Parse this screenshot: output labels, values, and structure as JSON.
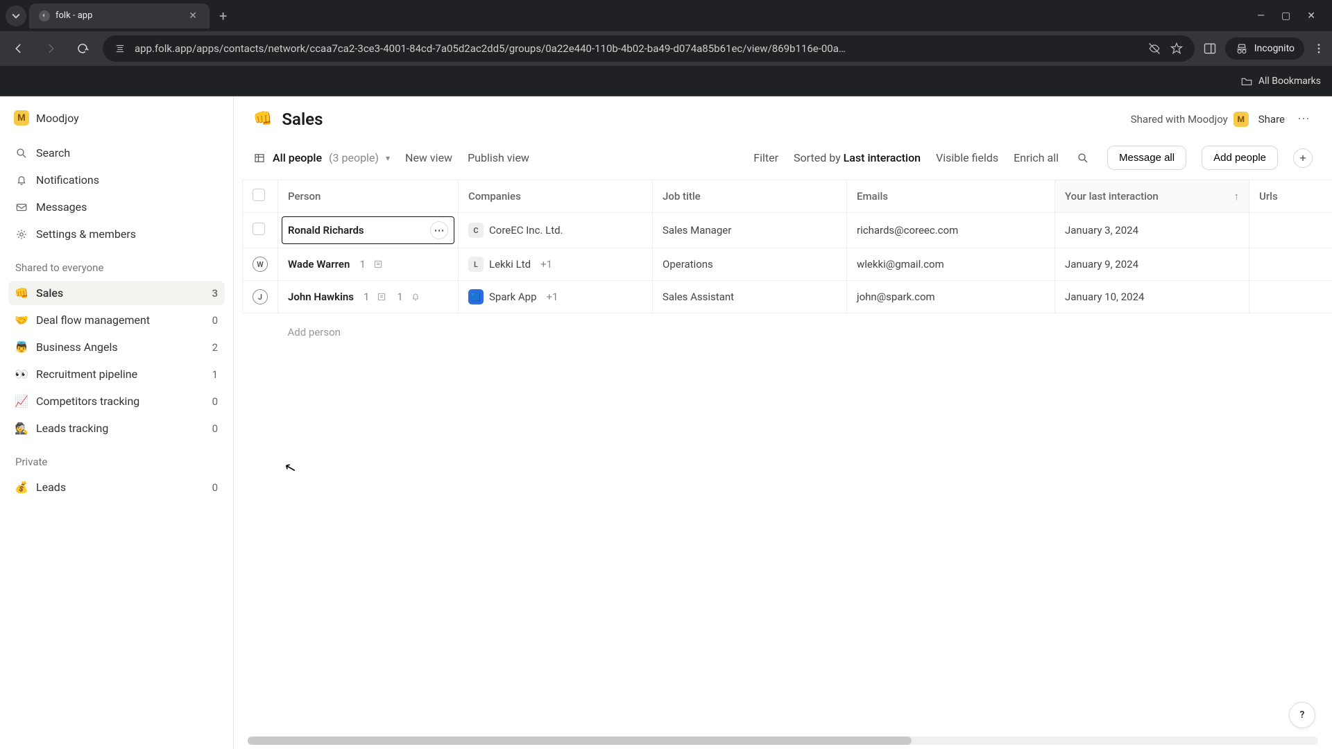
{
  "browser": {
    "tab_title": "folk - app",
    "url": "app.folk.app/apps/contacts/network/ccaa7ca2-3ce3-4001-84cd-7a05d2ac2dd5/groups/0a22e440-110b-4b02-ba49-d074a85b61ec/view/869b116e-00a…",
    "incognito_label": "Incognito",
    "all_bookmarks": "All Bookmarks"
  },
  "workspace": {
    "name": "Moodjoy",
    "initial": "M"
  },
  "sidebar": {
    "search": "Search",
    "notifications": "Notifications",
    "messages": "Messages",
    "settings": "Settings & members",
    "section_shared": "Shared to everyone",
    "section_private": "Private",
    "groups": [
      {
        "emoji": "👊",
        "name": "Sales",
        "count": "3",
        "active": true
      },
      {
        "emoji": "🤝",
        "name": "Deal flow management",
        "count": "0"
      },
      {
        "emoji": "👼",
        "name": "Business Angels",
        "count": "2"
      },
      {
        "emoji": "👀",
        "name": "Recruitment pipeline",
        "count": "1"
      },
      {
        "emoji": "📈",
        "name": "Competitors tracking",
        "count": "0"
      },
      {
        "emoji": "🕵️",
        "name": "Leads tracking",
        "count": "0"
      }
    ],
    "private_groups": [
      {
        "emoji": "💰",
        "name": "Leads",
        "count": "0"
      }
    ]
  },
  "page": {
    "emoji": "👊",
    "title": "Sales",
    "shared_with_label": "Shared with Moodjoy",
    "share": "Share"
  },
  "toolbar": {
    "view_label": "All people",
    "view_count": "(3 people)",
    "new_view": "New view",
    "publish_view": "Publish view",
    "filter": "Filter",
    "sorted_by": "Sorted by",
    "sort_field": "Last interaction",
    "visible_fields": "Visible fields",
    "enrich_all": "Enrich all",
    "message_all": "Message all",
    "add_people": "Add people"
  },
  "table": {
    "headers": {
      "person": "Person",
      "companies": "Companies",
      "job_title": "Job title",
      "emails": "Emails",
      "last_interaction": "Your last interaction",
      "urls": "Urls"
    },
    "rows": [
      {
        "selected": true,
        "initial": "",
        "name": "Ronald Richards",
        "notes": "",
        "reminders": "",
        "company_initial": "C",
        "company": "CoreEC Inc. Ltd.",
        "company_extra": "",
        "job": "Sales Manager",
        "email": "richards@coreec.com",
        "last": "January 3, 2024"
      },
      {
        "initial": "W",
        "name": "Wade Warren",
        "notes": "1",
        "reminders": "",
        "company_initial": "L",
        "company": "Lekki Ltd",
        "company_extra": "+1",
        "job": "Operations",
        "email": "wlekki@gmail.com",
        "last": "January 9, 2024"
      },
      {
        "initial": "J",
        "name": "John Hawkins",
        "notes": "1",
        "reminders": "1",
        "company_initial": "🟦",
        "company": "Spark App",
        "company_extra": "+1",
        "job": "Sales Assistant",
        "email": "john@spark.com",
        "last": "January 10, 2024"
      }
    ],
    "add_person": "Add person"
  },
  "help": "?"
}
